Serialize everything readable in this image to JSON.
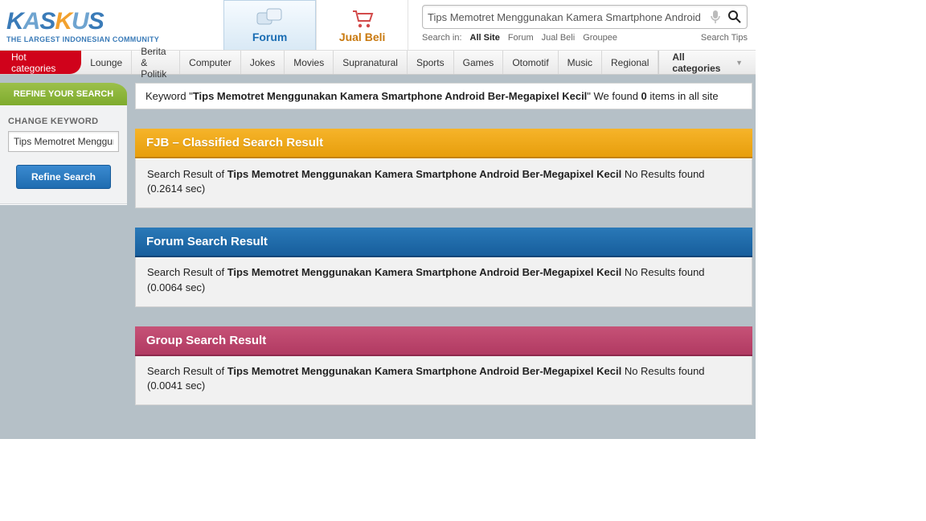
{
  "header": {
    "logo_tagline": "THE LARGEST INDONESIAN COMMUNITY",
    "tabs": {
      "forum": "Forum",
      "jualbeli": "Jual Beli"
    },
    "search_value": "Tips Memotret Menggunakan Kamera Smartphone Android",
    "search_in_label": "Search in:",
    "search_in_allsite": "All Site",
    "search_in_forum": "Forum",
    "search_in_jualbeli": "Jual Beli",
    "search_in_groupee": "Groupee",
    "search_tips": "Search Tips"
  },
  "catbar": {
    "hot": "Hot categories",
    "items": [
      "Lounge",
      "Berita & Politik",
      "Computer",
      "Jokes",
      "Movies",
      "Supranatural",
      "Sports",
      "Games",
      "Otomotif",
      "Music",
      "Regional"
    ],
    "allcat": "All categories"
  },
  "sidebar": {
    "refine_header": "REFINE YOUR SEARCH",
    "change_keyword_label": "CHANGE KEYWORD",
    "keyword_value": "Tips Memotret Menggunakan Kamera Smartphone Android Ber-Megapixel Kecil",
    "refine_btn": "Refine Search"
  },
  "kwbar": {
    "prefix": "Keyword \"",
    "keyword": "Tips Memotret Menggunakan Kamera Smartphone Android Ber-Megapixel Kecil",
    "mid": "\" We found ",
    "count": "0",
    "suffix": " items in all site"
  },
  "panels": {
    "fjb": {
      "title": "FJB – Classified Search Result",
      "body_prefix": "Search Result of ",
      "body_kw": "Tips Memotret Menggunakan Kamera Smartphone Android Ber-Megapixel Kecil",
      "body_suffix": "  No Results found (0.2614 sec)"
    },
    "forum": {
      "title": "Forum Search Result",
      "body_prefix": "Search Result of ",
      "body_kw": "Tips Memotret Menggunakan Kamera Smartphone Android Ber-Megapixel Kecil",
      "body_suffix": " No Results found (0.0064 sec)"
    },
    "group": {
      "title": "Group Search Result",
      "body_prefix": "Search Result of ",
      "body_kw": "Tips Memotret Menggunakan Kamera Smartphone Android Ber-Megapixel Kecil",
      "body_suffix": " No Results found (0.0041 sec)"
    }
  }
}
